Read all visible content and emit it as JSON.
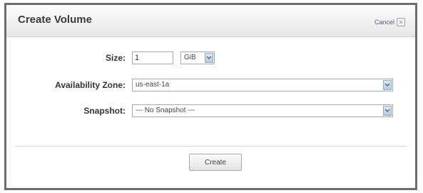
{
  "dialog": {
    "title": "Create Volume",
    "cancel_label": "Cancel",
    "close_icon": "close-icon"
  },
  "form": {
    "size": {
      "label": "Size:",
      "value": "1",
      "unit": "GiB"
    },
    "availability_zone": {
      "label": "Availability Zone:",
      "value": "us-east-1a"
    },
    "snapshot": {
      "label": "Snapshot:",
      "value": "--- No Snapshot ---"
    }
  },
  "actions": {
    "create_label": "Create"
  }
}
